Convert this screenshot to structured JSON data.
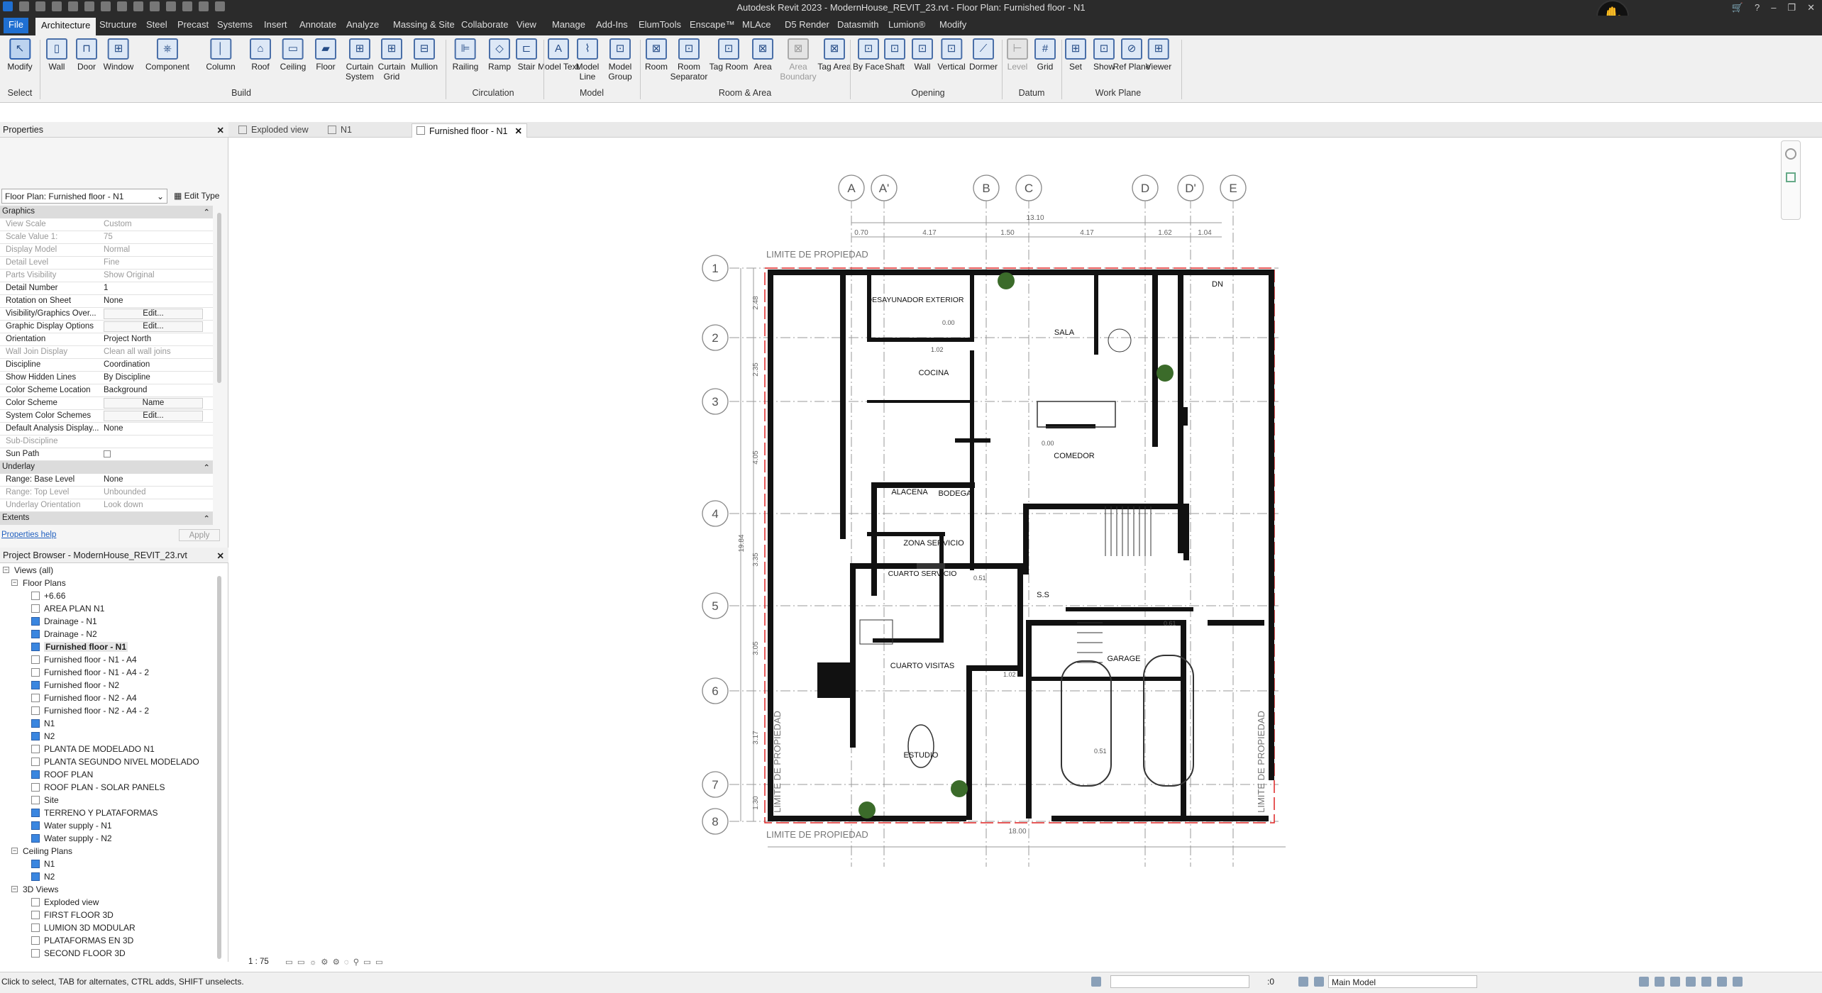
{
  "window": {
    "title": "Autodesk Revit 2023 - ModernHouse_REVIT_23.rvt - Floor Plan: Furnished floor - N1"
  },
  "menu": {
    "tabs": [
      "File",
      "Architecture",
      "Structure",
      "Steel",
      "Precast",
      "Systems",
      "Insert",
      "Annotate",
      "Analyze",
      "Massing & Site",
      "Collaborate",
      "View",
      "Manage",
      "Add-Ins",
      "ElumTools",
      "Enscape™",
      "MLAce",
      "D5 Render",
      "Datasmith",
      "Lumion®",
      "Modify"
    ]
  },
  "ribbon": {
    "buttons": [
      "Modify",
      "Wall",
      "Door",
      "Window",
      "Component",
      "Column",
      "Roof",
      "Ceiling",
      "Floor",
      "Curtain System",
      "Curtain Grid",
      "Mullion",
      "Railing",
      "Ramp",
      "Stair",
      "Model Text",
      "Model Line",
      "Model Group",
      "Room",
      "Room Separator",
      "Tag Room",
      "Area",
      "Area Boundary",
      "Tag Area",
      "By Face",
      "Shaft",
      "Wall",
      "Vertical",
      "Dormer",
      "Level",
      "Grid",
      "Set",
      "Show",
      "Ref Plane",
      "Viewer"
    ],
    "groups": [
      "Select",
      "Build",
      "Circulation",
      "Model",
      "Room & Area",
      "Opening",
      "Datum",
      "Work Plane"
    ]
  },
  "properties": {
    "title": "Properties",
    "type_selector": "Floor Plan: Furnished floor - N1",
    "edit_type": "Edit Type",
    "sections": {
      "graphics": "Graphics",
      "underlay": "Underlay",
      "extents": "Extents"
    },
    "rows": [
      {
        "k": "View Scale",
        "v": "Custom"
      },
      {
        "k": "Scale Value    1:",
        "v": "75"
      },
      {
        "k": "Display Model",
        "v": "Normal"
      },
      {
        "k": "Detail Level",
        "v": "Fine"
      },
      {
        "k": "Parts Visibility",
        "v": "Show Original"
      },
      {
        "k": "Detail Number",
        "v": "1"
      },
      {
        "k": "Rotation on Sheet",
        "v": "None"
      },
      {
        "k": "Visibility/Graphics Over...",
        "v": "Edit..."
      },
      {
        "k": "Graphic Display Options",
        "v": "Edit..."
      },
      {
        "k": "Orientation",
        "v": "Project North"
      },
      {
        "k": "Wall Join Display",
        "v": "Clean all wall joins"
      },
      {
        "k": "Discipline",
        "v": "Coordination"
      },
      {
        "k": "Show Hidden Lines",
        "v": "By Discipline"
      },
      {
        "k": "Color Scheme Location",
        "v": "Background"
      },
      {
        "k": "Color Scheme",
        "v": "Name"
      },
      {
        "k": "System Color Schemes",
        "v": "Edit..."
      },
      {
        "k": "Default Analysis Display...",
        "v": "None"
      },
      {
        "k": "Sub-Discipline",
        "v": ""
      },
      {
        "k": "Sun Path",
        "v": ""
      }
    ],
    "underlay_rows": [
      {
        "k": "Range: Base Level",
        "v": "None"
      },
      {
        "k": "Range: Top Level",
        "v": "Unbounded"
      },
      {
        "k": "Underlay Orientation",
        "v": "Look down"
      }
    ],
    "help_link": "Properties help",
    "apply": "Apply"
  },
  "browser": {
    "title": "Project Browser - ModernHouse_REVIT_23.rvt",
    "root": "Views (all)",
    "floor_plans": "Floor Plans",
    "floor_items": [
      "+6.66",
      "AREA PLAN N1",
      "Drainage - N1",
      "Drainage - N2",
      "Furnished floor - N1",
      "Furnished floor - N1 - A4",
      "Furnished floor - N1 - A4 - 2",
      "Furnished floor - N2",
      "Furnished floor - N2 - A4",
      "Furnished floor - N2 - A4 - 2",
      "N1",
      "N2",
      "PLANTA DE MODELADO N1",
      "PLANTA SEGUNDO NIVEL MODELADO",
      "ROOF PLAN",
      "ROOF PLAN - SOLAR PANELS",
      "Site",
      "TERRENO Y PLATAFORMAS",
      "Water supply - N1",
      "Water supply - N2"
    ],
    "ceiling_plans": "Ceiling Plans",
    "ceiling_items": [
      "N1",
      "N2"
    ],
    "views3d": "3D Views",
    "views3d_items": [
      "Exploded view",
      "FIRST FLOOR 3D",
      "LUMION 3D MODULAR",
      "PLATAFORMAS EN 3D",
      "SECOND FLOOR 3D"
    ]
  },
  "view_tabs": [
    "Exploded view",
    "N1",
    "Furnished floor - N1"
  ],
  "plan": {
    "grid_cols": [
      "A",
      "A'",
      "B",
      "C",
      "D",
      "D'",
      "E"
    ],
    "grid_rows": [
      "1",
      "2",
      "3",
      "4",
      "5",
      "6",
      "7",
      "8"
    ],
    "top_dims": [
      "0.70",
      "4.17",
      "1.50",
      "4.17",
      "1.62",
      "1.04"
    ],
    "top_total": "13.10",
    "bottom_total": "18.00",
    "left_dims": [
      "2.48",
      "2.35",
      "4.05",
      "3.35",
      "3.05",
      "3.17",
      "1.30"
    ],
    "left_total": "19.84",
    "boundary_label": "LIMITE DE PROPIEDAD",
    "rooms": [
      "DESAYUNADOR EXTERIOR",
      "SALA",
      "COCINA",
      "COMEDOR",
      "ALACENA",
      "BODEGA",
      "ZONA SERVICIO",
      "CUARTO SERVICIO",
      "CUARTO VISITAS",
      "ESTUDIO",
      "GARAGE",
      "S.S",
      "DN"
    ],
    "levels": [
      "0.00",
      "1.02",
      "0.51",
      "0.61",
      "1.02",
      "0.00",
      "0.51"
    ]
  },
  "view_control": {
    "scale": "1 : 75"
  },
  "status": {
    "message": "Click to select, TAB for alternates, CTRL adds, SHIFT unselects.",
    "zero": ":0",
    "model": "Main Model"
  }
}
